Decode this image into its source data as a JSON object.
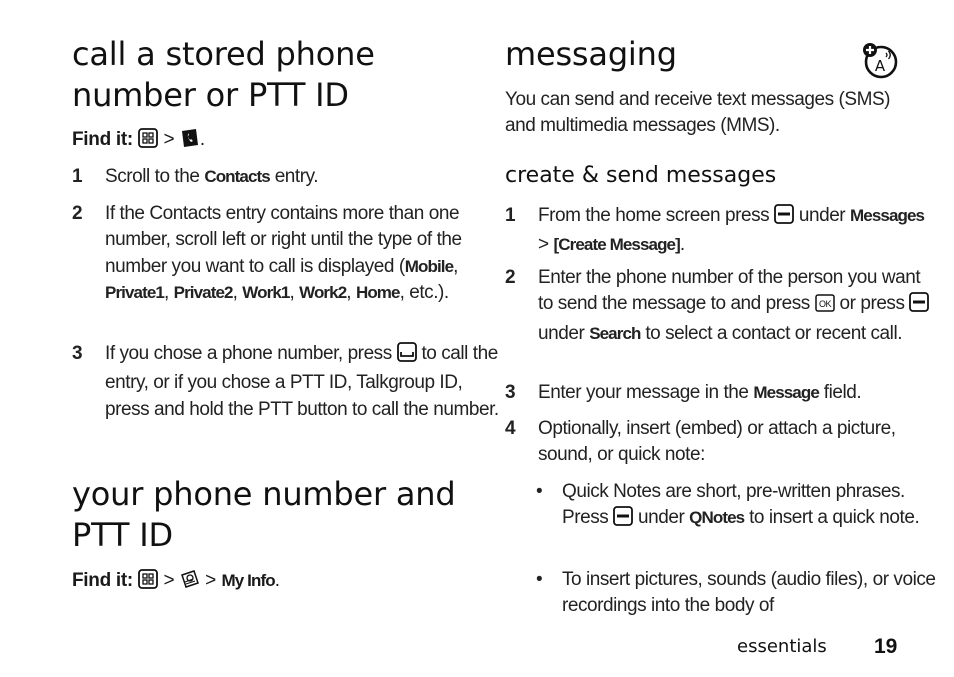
{
  "left": {
    "section1": {
      "title_line1": "call a stored phone",
      "title_line2": "number or PTT ID",
      "findit": {
        "label": "Find it:",
        "icons": [
          "menu-key-icon",
          "contacts-icon"
        ],
        "separator": ">",
        "end": "."
      },
      "steps": [
        {
          "num": "1",
          "pre": "Scroll to the ",
          "key": "Contacts",
          "post": " entry."
        },
        {
          "num": "2",
          "text": "If the Contacts entry contains more than one number, scroll left or right until the type of the number you want to call is displayed (",
          "keys": [
            "Mobile",
            "Private1",
            "Private2",
            "Work1",
            "Work2",
            "Home"
          ],
          "sep": ", ",
          "post": ", etc.)."
        },
        {
          "num": "3",
          "pre": "If you chose a phone number, press ",
          "icon": "send-key-icon",
          "post": " to call the entry, or if you chose a PTT ID, Talkgroup ID, press and hold the PTT button to call the number."
        }
      ]
    },
    "section2": {
      "title_line1": "your phone number and",
      "title_line2": "PTT ID",
      "findit": {
        "label": "Find it:",
        "icons": [
          "menu-key-icon",
          "settings-icon"
        ],
        "separator": ">",
        "key": "My Info",
        "end": "."
      }
    }
  },
  "right": {
    "title": "messaging",
    "badge_icon": "feature-availability-icon",
    "intro": "You can send and receive text messages (SMS) and multimedia messages (MMS).",
    "subsection": {
      "title": "create & send messages",
      "steps": [
        {
          "num": "1",
          "pre": "From the home screen press ",
          "icon": "soft-key-icon",
          "mid": " under ",
          "key1": "Messages",
          "sep": " > ",
          "key2": "[Create Message]",
          "post": "."
        },
        {
          "num": "2",
          "pre": "Enter the phone number of the person you want to send the message to and press ",
          "icon1": "ok-key-icon",
          "mid": " or press ",
          "icon2": "soft-key-icon",
          "mid2": " under ",
          "key": "Search",
          "post": " to select a contact or recent call."
        },
        {
          "num": "3",
          "pre": "Enter your message in the ",
          "key": "Message",
          "post": " field."
        },
        {
          "num": "4",
          "text": "Optionally, insert (embed) or attach a picture, sound, or quick note:"
        }
      ],
      "bullets": [
        {
          "pre": "Quick Notes are short, pre-written phrases. Press ",
          "icon": "soft-key-icon",
          "mid": " under ",
          "key": "QNotes",
          "post": " to insert a quick note."
        },
        {
          "text": "To insert pictures, sounds (audio files), or voice recordings into the body of"
        }
      ]
    }
  },
  "footer": {
    "section_label": "essentials",
    "page_number": "19"
  }
}
